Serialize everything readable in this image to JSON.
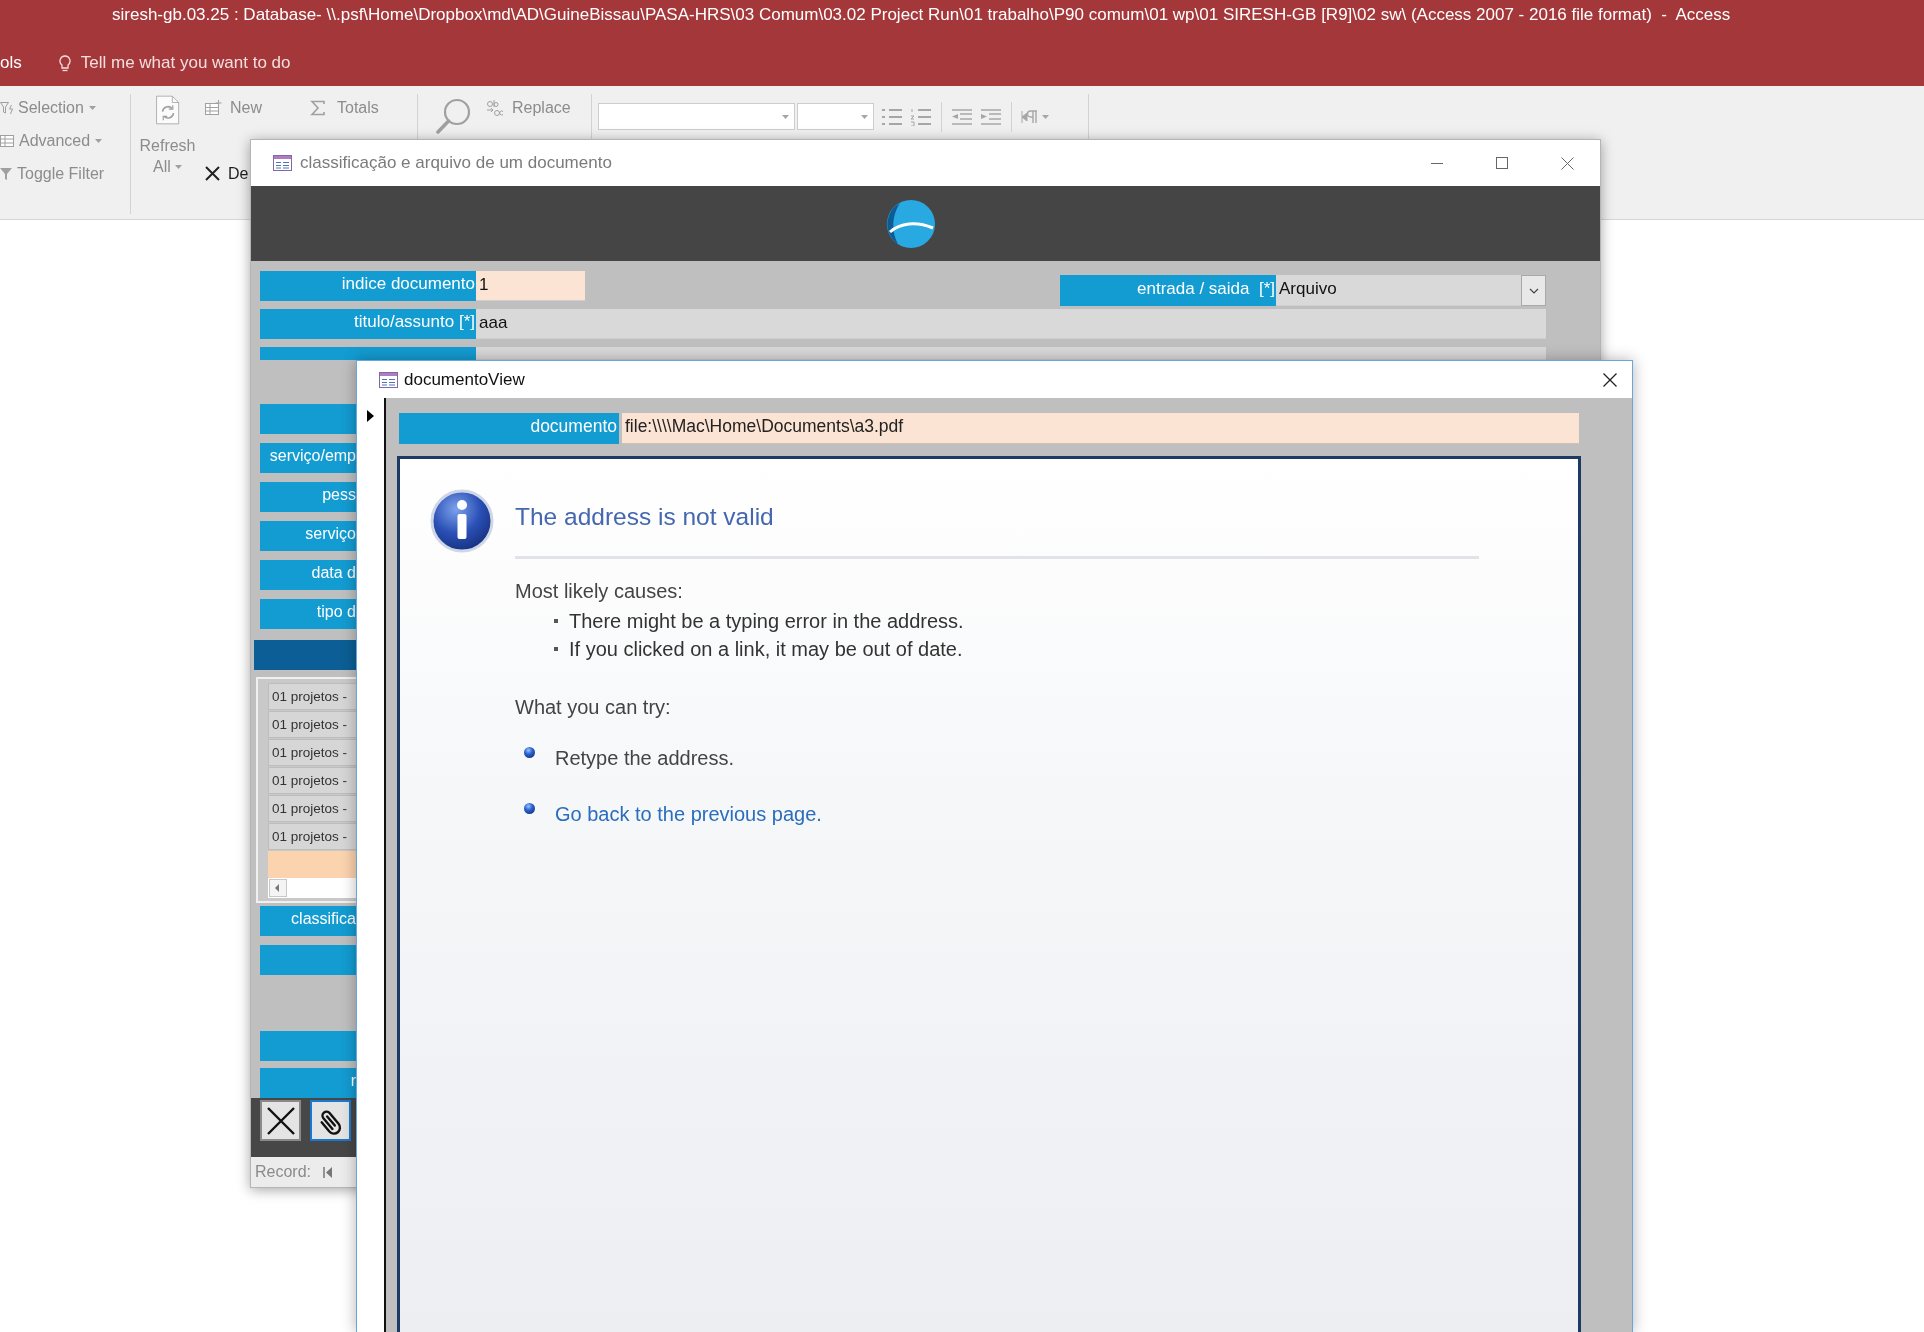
{
  "app_window": {
    "title": "siresh-gb.03.25 : Database- \\\\.psf\\Home\\Dropbox\\md\\AD\\GuineBissau\\PASA-HRS\\03 Comum\\03.02 Project Run\\01 trabalho\\P90 comum\\01 wp\\01 SIRESH-GB [R9]\\02 sw\\ (Access 2007 - 2016 file format)  -  Access",
    "ribbon_tab": "ols",
    "tell_me": "Tell me what you want to do"
  },
  "ribbon": {
    "filter_commands": [
      {
        "kind": "selection",
        "label": "Selection",
        "dropdown": true,
        "disabled": true
      },
      {
        "kind": "advanced",
        "label": "Advanced",
        "dropdown": true,
        "disabled": true
      },
      {
        "kind": "toggle_filter",
        "label": "Toggle Filter",
        "dropdown": false,
        "disabled": true
      }
    ],
    "refresh": {
      "label": "Refresh",
      "sub_label": "All",
      "dropdown": true,
      "disabled": true
    },
    "record_commands": [
      {
        "kind": "new",
        "label": "New",
        "disabled": true
      },
      {
        "kind": "delete",
        "label": "De",
        "disabled": false
      }
    ],
    "totals": {
      "label": "Totals",
      "disabled": true
    },
    "find": {
      "disabled": true
    },
    "replace": {
      "label": "Replace",
      "disabled": true
    }
  },
  "record_form": {
    "title": "classificação e arquivo de um documento",
    "active": false,
    "top_rows": [
      {
        "fields": [
          {
            "kind": "text",
            "label": "indice documento",
            "value": "1",
            "highlighted": true
          },
          {
            "kind": "combo",
            "label": "entrada / saida  [*]",
            "value": "Arquivo",
            "highlighted": false
          }
        ]
      },
      {
        "fields": [
          {
            "kind": "text",
            "label": "titulo/assunto [*]",
            "value": "aaa",
            "highlighted": false
          }
        ]
      },
      {
        "fields": [
          {
            "kind": "blank",
            "highlighted": false
          }
        ]
      }
    ],
    "side_labels": [
      {
        "kind": "blank"
      },
      {
        "kind": "label",
        "label": "serviço/emp"
      },
      {
        "kind": "label",
        "label": "pess"
      },
      {
        "kind": "label",
        "label": "serviço"
      },
      {
        "kind": "label",
        "label": "data d"
      },
      {
        "kind": "label",
        "label": "tipo d"
      },
      {
        "kind": "section"
      }
    ],
    "subform": {
      "rows": [
        "01 projetos -",
        "01 projetos -",
        "01 projetos -",
        "01 projetos -",
        "01 projetos -",
        "01 projetos -"
      ],
      "new_record_row": true
    },
    "lower_labels": [
      {
        "kind": "label",
        "label": "classifica"
      },
      {
        "kind": "blank"
      }
    ],
    "footer_labels": [
      {
        "kind": "blank"
      },
      {
        "kind": "label",
        "label": "r"
      }
    ],
    "buttons": [
      {
        "kind": "cancel",
        "focused": false
      },
      {
        "kind": "attach",
        "focused": true
      }
    ],
    "record_bar": {
      "label": "Record:"
    }
  },
  "viewer_window": {
    "title": "documentoView",
    "active": true,
    "current_record": true,
    "field": {
      "label": "documento",
      "value": "file:\\\\\\\\Mac\\Home\\Documents\\a3.pdf",
      "highlighted": true
    },
    "error_page": {
      "heading": "The address is not valid",
      "causes_title": "Most likely causes:",
      "causes": [
        "There might be a typing error in the address.",
        "If you clicked on a link, it may be out of date."
      ],
      "try_title": "What you can try:",
      "actions": [
        {
          "kind": "text",
          "text": "Retype the address."
        },
        {
          "kind": "link",
          "text": "Go back to the previous page."
        }
      ]
    }
  }
}
